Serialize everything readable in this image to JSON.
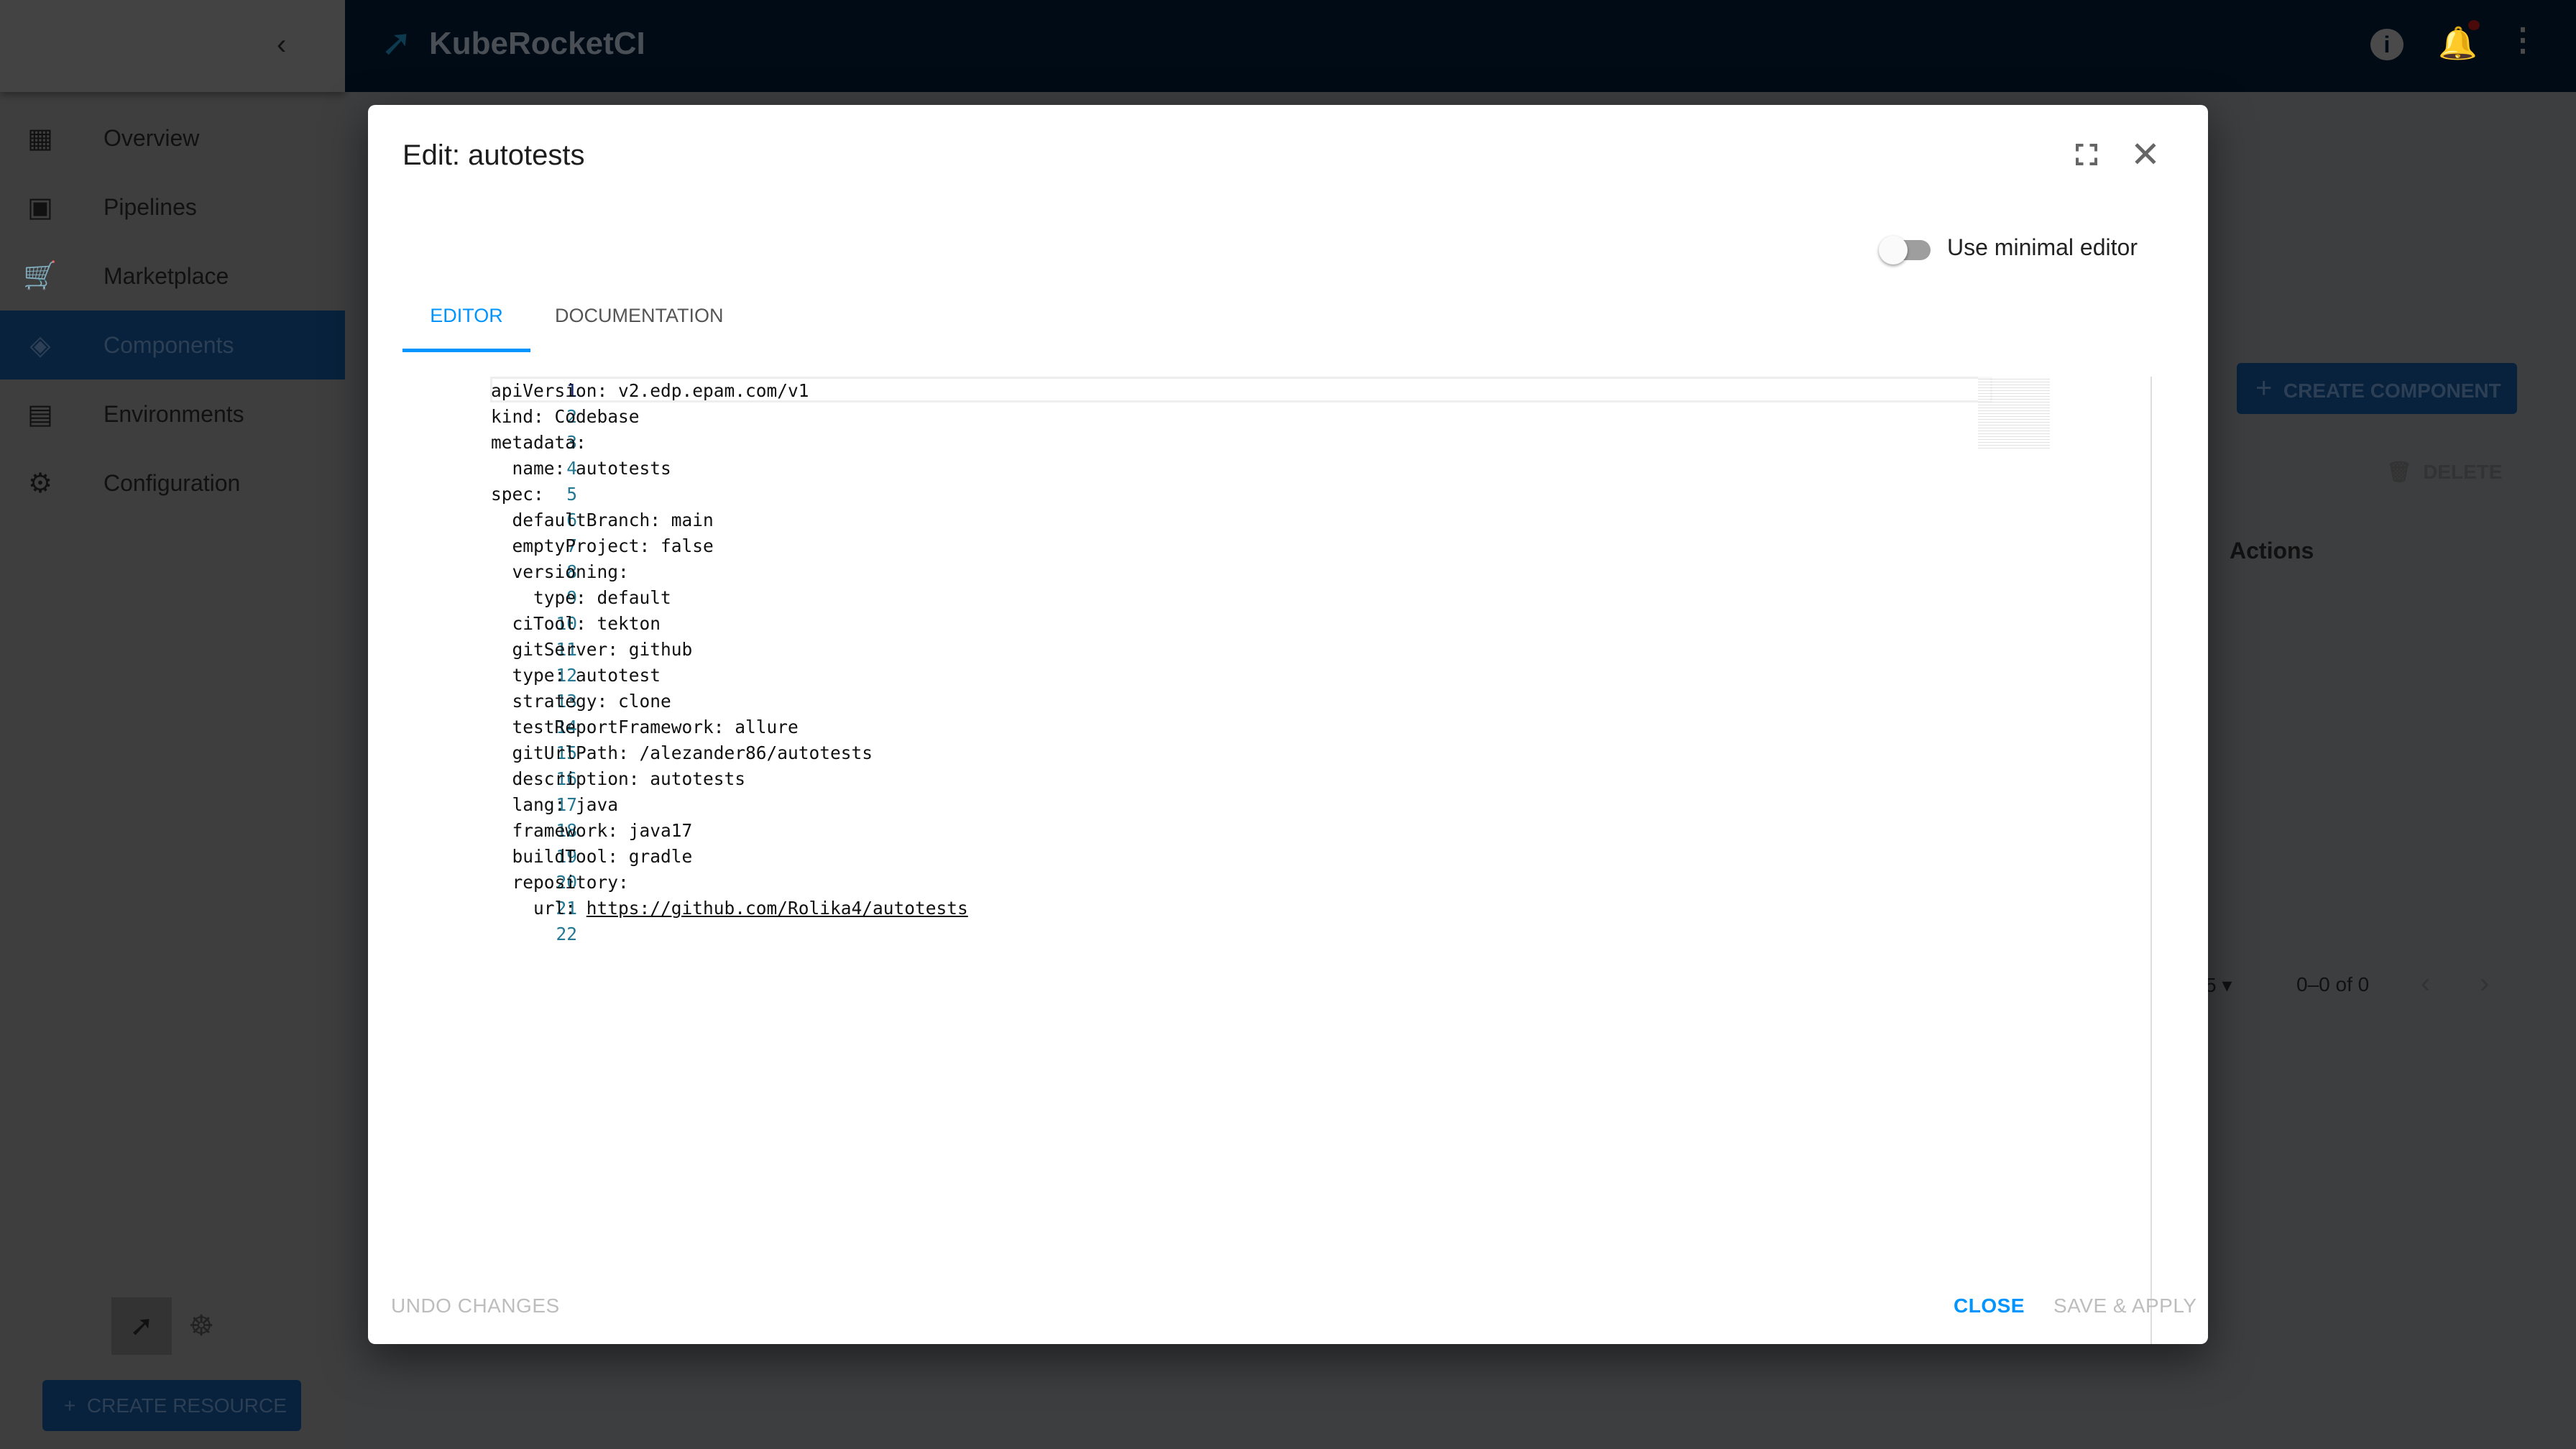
{
  "app": {
    "title": "KubeRocketCI"
  },
  "sidebar": {
    "items": [
      {
        "label": "Overview",
        "icon": "dashboard-icon"
      },
      {
        "label": "Pipelines",
        "icon": "pipelines-icon"
      },
      {
        "label": "Marketplace",
        "icon": "cart-icon"
      },
      {
        "label": "Components",
        "icon": "layers-icon",
        "active": true
      },
      {
        "label": "Environments",
        "icon": "environments-icon"
      },
      {
        "label": "Configuration",
        "icon": "gear-icon"
      }
    ],
    "create_resource": "CREATE RESOURCE"
  },
  "background": {
    "create_component": "CREATE COMPONENT",
    "delete": "DELETE",
    "actions_header": "Actions",
    "rows_per_page": "5",
    "pagination": "0–0 of 0"
  },
  "modal": {
    "title": "Edit: autotests",
    "toggle_label": "Use minimal editor",
    "toggle_on": false,
    "tabs": [
      {
        "label": "EDITOR",
        "active": true
      },
      {
        "label": "DOCUMENTATION"
      }
    ],
    "lines": [
      "apiVersion: v2.edp.epam.com/v1",
      "kind: Codebase",
      "metadata:",
      "  name: autotests",
      "spec:",
      "  defaultBranch: main",
      "  emptyProject: false",
      "  versioning:",
      "    type: default",
      "  ciTool: tekton",
      "  gitServer: github",
      "  type: autotest",
      "  strategy: clone",
      "  testReportFramework: allure",
      "  gitUrlPath: /alezander86/autotests",
      "  description: autotests",
      "  lang: java",
      "  framework: java17",
      "  buildTool: gradle",
      "  repository:",
      "    url: https://github.com/Rolika4/autotests",
      ""
    ],
    "url_link": "https://github.com/Rolika4/autotests",
    "undo": "UNDO CHANGES",
    "close": "CLOSE",
    "save": "SAVE & APPLY"
  },
  "colors": {
    "accent": "#0094ff",
    "topbar": "#010b16"
  }
}
